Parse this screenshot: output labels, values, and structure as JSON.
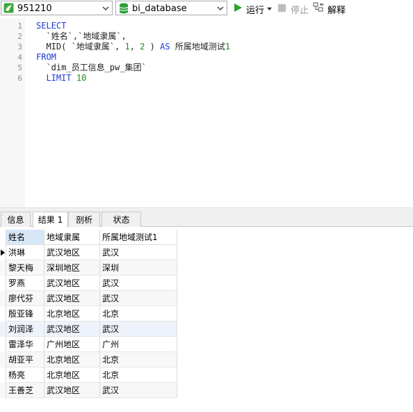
{
  "toolbar": {
    "connection": "951210",
    "database": "bi_database",
    "run_label": "运行",
    "stop_label": "停止",
    "explain_label": "解释"
  },
  "editor": {
    "lines": [
      {
        "n": "1",
        "parts": [
          {
            "t": "SELECT",
            "c": "kw"
          }
        ]
      },
      {
        "n": "2",
        "parts": [
          {
            "t": "  `姓名`,`地域隶属`,",
            "c": "plain"
          }
        ]
      },
      {
        "n": "3",
        "parts": [
          {
            "t": "  MID( `地域隶属`, ",
            "c": "plain"
          },
          {
            "t": "1",
            "c": "num"
          },
          {
            "t": ", ",
            "c": "plain"
          },
          {
            "t": "2",
            "c": "num"
          },
          {
            "t": " ) ",
            "c": "plain"
          },
          {
            "t": "AS",
            "c": "kw"
          },
          {
            "t": " 所属地域测试",
            "c": "plain"
          },
          {
            "t": "1",
            "c": "num"
          }
        ]
      },
      {
        "n": "4",
        "parts": [
          {
            "t": "FROM",
            "c": "kw"
          }
        ]
      },
      {
        "n": "5",
        "parts": [
          {
            "t": "  `dim_员工信息_pw_集团`",
            "c": "plain"
          }
        ]
      },
      {
        "n": "6",
        "parts": [
          {
            "t": "  ",
            "c": "plain"
          },
          {
            "t": "LIMIT",
            "c": "kw"
          },
          {
            "t": " ",
            "c": "plain"
          },
          {
            "t": "10",
            "c": "num"
          }
        ]
      }
    ]
  },
  "tabs": [
    {
      "label": "信息",
      "active": false
    },
    {
      "label": "结果 1",
      "active": true
    },
    {
      "label": "剖析",
      "active": false
    },
    {
      "label": "状态",
      "active": false
    }
  ],
  "grid": {
    "columns": [
      "姓名",
      "地域隶属",
      "所属地域测试1"
    ],
    "rows": [
      [
        "洪琳",
        "武汉地区",
        "武汉"
      ],
      [
        "黎天梅",
        "深圳地区",
        "深圳"
      ],
      [
        "罗燕",
        "武汉地区",
        "武汉"
      ],
      [
        "廖代芬",
        "武汉地区",
        "武汉"
      ],
      [
        "殷亚锋",
        "北京地区",
        "北京"
      ],
      [
        "刘润泽",
        "武汉地区",
        "武汉"
      ],
      [
        "雷泽华",
        "广州地区",
        "广州"
      ],
      [
        "胡亚平",
        "北京地区",
        "北京"
      ],
      [
        "杨亮",
        "北京地区",
        "北京"
      ],
      [
        "王善芝",
        "武汉地区",
        "武汉"
      ]
    ]
  },
  "colors": {
    "keyword": "#1d38d6",
    "number": "#1a8a1a",
    "run_green": "#2aa52a",
    "db_green": "#2f9e3a"
  }
}
